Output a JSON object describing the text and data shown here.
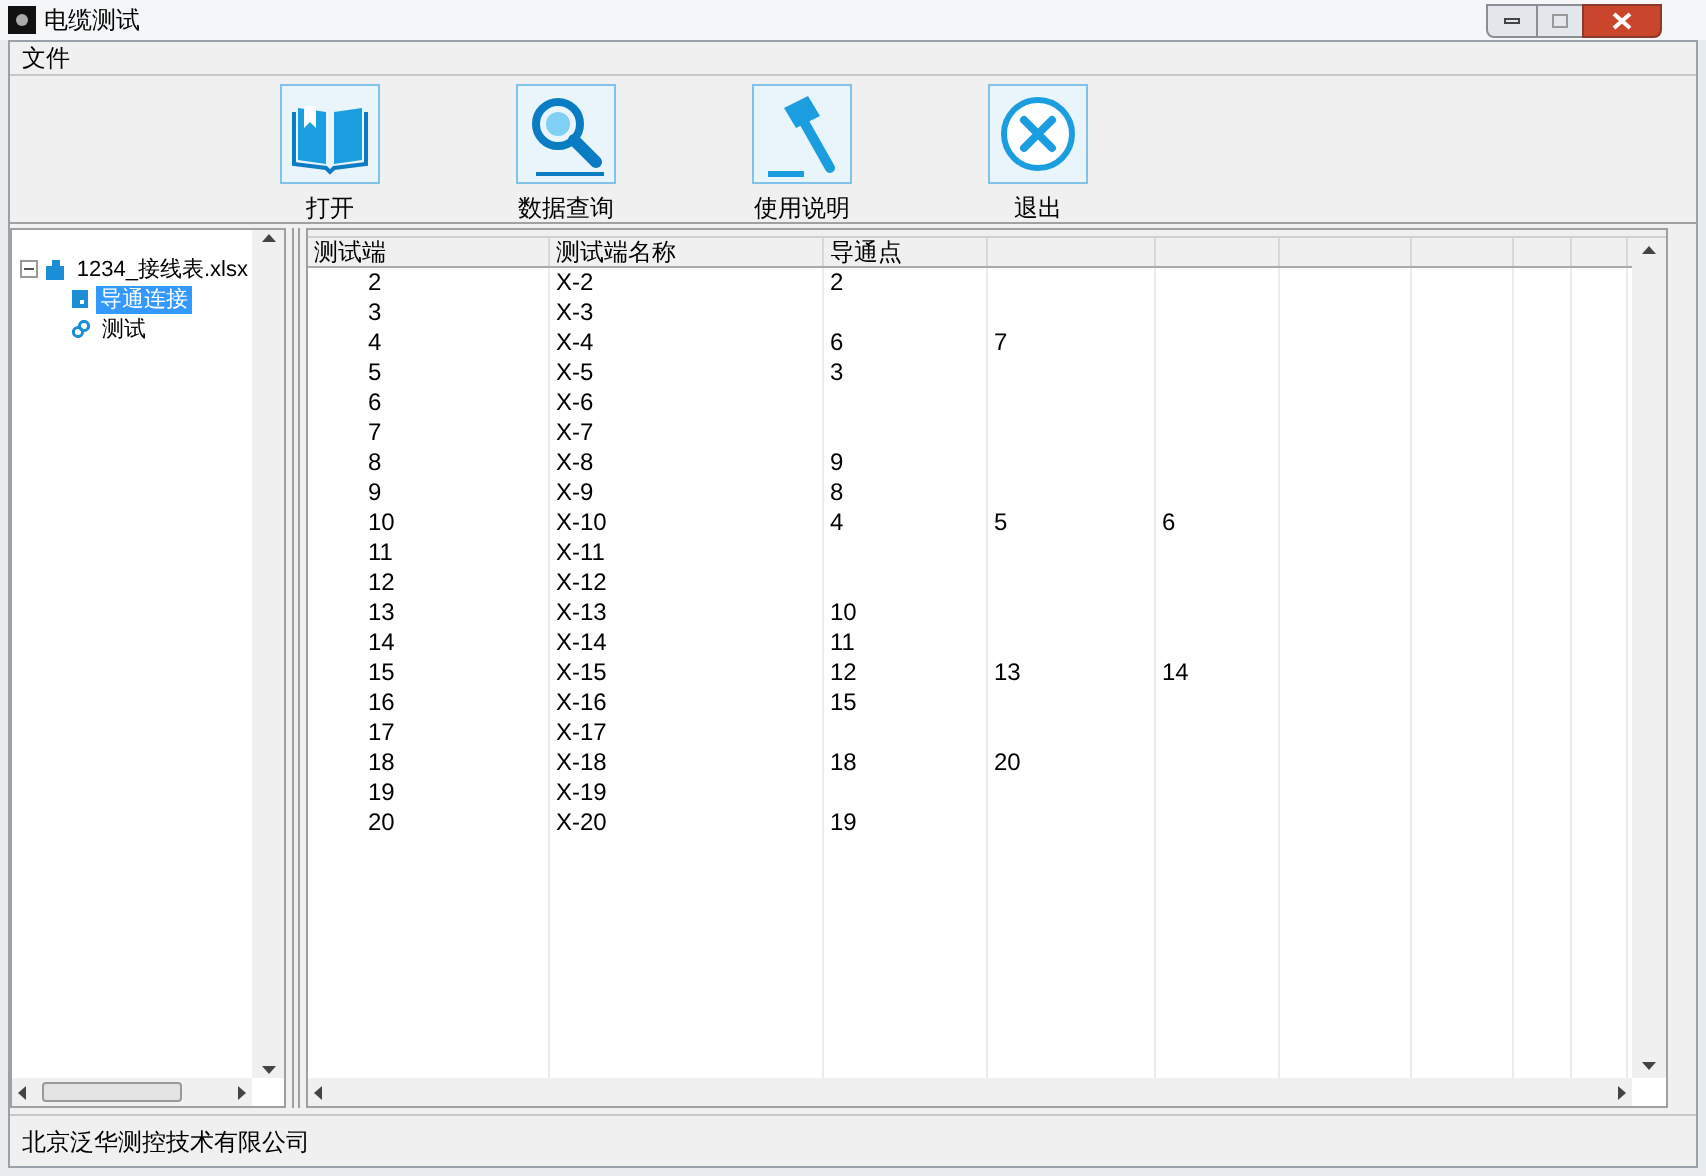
{
  "window": {
    "title": "电缆测试"
  },
  "menu": [
    "文件"
  ],
  "toolbar": [
    {
      "kind": "book",
      "label": "打开"
    },
    {
      "kind": "search",
      "label": "数据查询"
    },
    {
      "kind": "hammer",
      "label": "使用说明"
    },
    {
      "kind": "close",
      "label": "退出"
    }
  ],
  "tree": [
    {
      "label": "1234_接线表.xlsx",
      "expanded": true,
      "selected": false,
      "children": [
        {
          "label": "导通连接",
          "selected": true
        },
        {
          "label": "测试",
          "selected": false
        }
      ]
    }
  ],
  "table": {
    "columns": [
      "测试端",
      "测试端名称",
      "导通点"
    ],
    "rows": [
      [
        "2",
        "X-2",
        "2"
      ],
      [
        "3",
        "X-3"
      ],
      [
        "4",
        "X-4",
        "6",
        "7"
      ],
      [
        "5",
        "X-5",
        "3"
      ],
      [
        "6",
        "X-6"
      ],
      [
        "7",
        "X-7"
      ],
      [
        "8",
        "X-8",
        "9"
      ],
      [
        "9",
        "X-9",
        "8"
      ],
      [
        "10",
        "X-10",
        "4",
        "5",
        "6"
      ],
      [
        "11",
        "X-11"
      ],
      [
        "12",
        "X-12"
      ],
      [
        "13",
        "X-13",
        "10"
      ],
      [
        "14",
        "X-14",
        "11"
      ],
      [
        "15",
        "X-15",
        "12",
        "13",
        "14"
      ],
      [
        "16",
        "X-16",
        "15"
      ],
      [
        "17",
        "X-17"
      ],
      [
        "18",
        "X-18",
        "18",
        "20"
      ],
      [
        "19",
        "X-19"
      ],
      [
        "20",
        "X-20",
        "19"
      ]
    ]
  },
  "status_bar": "北京泛华测控技术有限公司"
}
